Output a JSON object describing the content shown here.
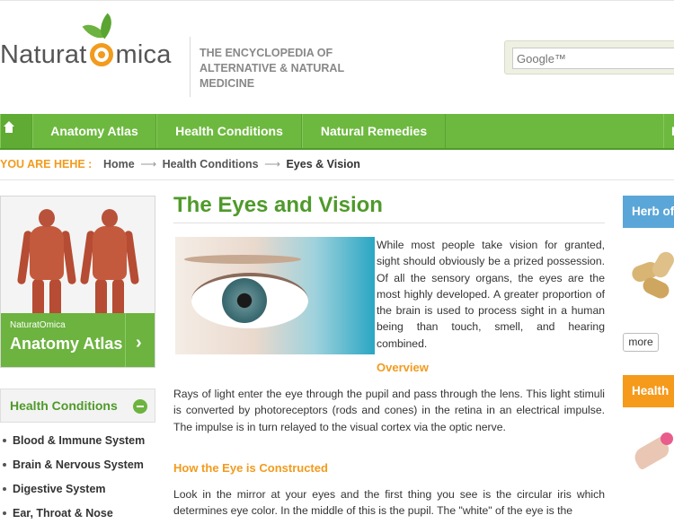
{
  "header": {
    "logo_text_before": "Naturat",
    "logo_text_after": "mica",
    "tagline": "THE ENCYCLOPEDIA OF ALTERNATIVE & NATURAL MEDICINE",
    "search_placeholder": "Google™"
  },
  "nav": {
    "items": [
      "Anatomy Atlas",
      "Health Conditions",
      "Natural Remedies",
      "I"
    ]
  },
  "breadcrumb": {
    "label": "YOU ARE HEHE :",
    "items": [
      "Home",
      "Health Conditions",
      "Eyes & Vision"
    ],
    "separator": "⟶"
  },
  "sidebar": {
    "atlas_mini_logo": "NaturatOmica",
    "atlas_title": "Anatomy Atlas",
    "health_conditions_title": "Health Conditions",
    "health_conditions": [
      "Blood & Immune System",
      "Brain & Nervous System",
      "Digestive System",
      "Ear, Throat & Nose"
    ]
  },
  "main": {
    "title": "The Eyes and Vision",
    "intro": "While most people take vision for granted, sight should obviously be a prized possession. Of all the sensory organs, the eyes are the most highly developed. A greater proportion of the brain is used to process sight in a human being than touch, smell, and hearing combined.",
    "overview_heading": "Overview",
    "overview_text": "Rays of light enter the eye through the pupil and pass through the lens. This light stimuli is converted by photoreceptors (rods and cones) in the retina in an electrical impulse. The impulse is in turn relayed to the visual cortex via the optic nerve.",
    "construct_heading": "How the Eye is Constructed",
    "construct_text": "Look in the mirror at your eyes and the first thing you see is the circular iris which determines eye color. In the middle of this is the pupil. The \"white\" of the eye is the"
  },
  "right_sidebar": {
    "herb_title": "Herb of",
    "more_label": "more",
    "health_title": "Health"
  },
  "colors": {
    "brand_green": "#6db93f",
    "accent_orange": "#f29b1d",
    "herb_blue": "#5ba6d8",
    "health_orange": "#f59a1b"
  },
  "icons": [
    "home-icon",
    "chevron-right-icon",
    "collapse-minus-icon"
  ]
}
